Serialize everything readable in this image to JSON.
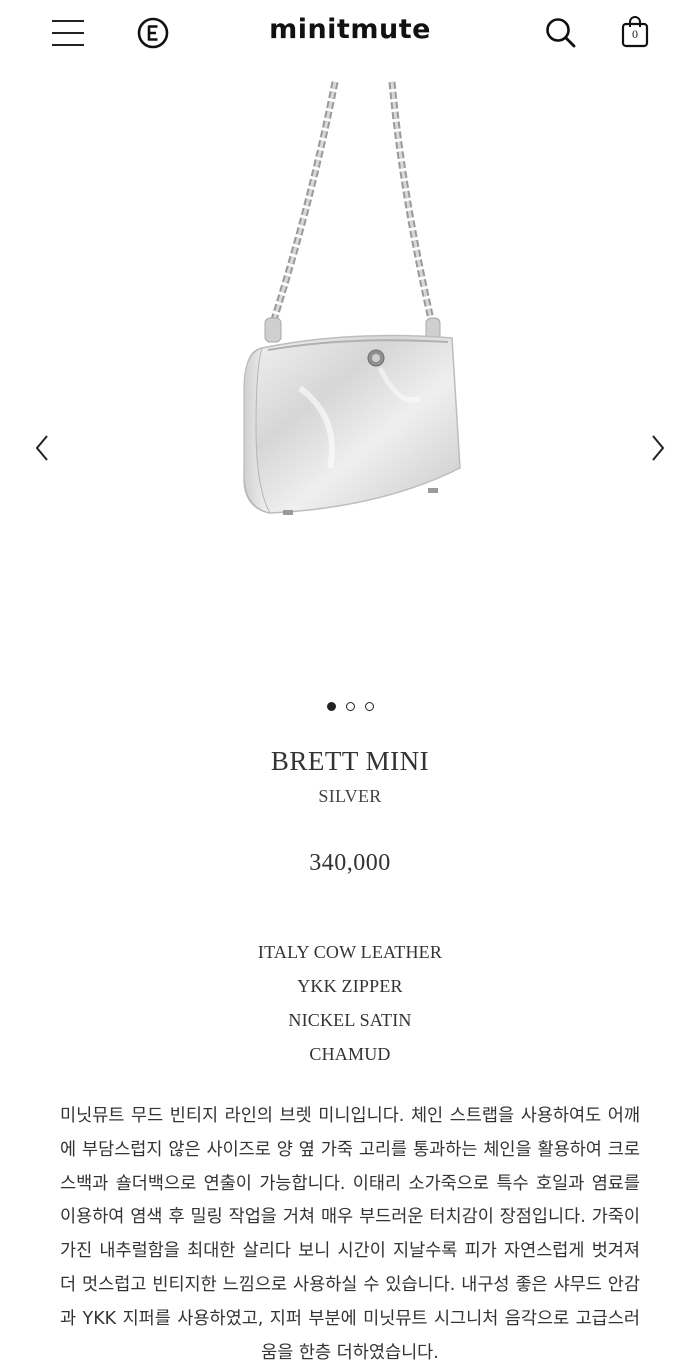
{
  "header": {
    "brand": "minitmute",
    "cart_count": "0"
  },
  "gallery": {
    "slide_count": 3,
    "active_index": 0
  },
  "product": {
    "name": "BRETT MINI",
    "color": "SILVER",
    "price": "340,000",
    "specs": [
      "ITALY COW LEATHER",
      "YKK ZIPPER",
      "NICKEL SATIN",
      "CHAMUD"
    ],
    "description": "미닛뮤트 무드 빈티지 라인의 브렛 미니입니다. 체인 스트랩을 사용하여도 어깨에 부담스럽지 않은 사이즈로 양 옆 가죽 고리를 통과하는 체인을 활용하여 크로스백과 숄더백으로 연출이 가능합니다. 이태리 소가죽으로 특수 호일과 염료를 이용하여 염색 후 밀링 작업을 거쳐 매우 부드러운 터치감이 장점입니다. 가죽이 가진 내추럴함을 최대한 살리다 보니 시간이 지날수록 피가 자연스럽게 벗겨져 더 멋스럽고 빈티지한 느낌으로 사용하실 수 있습니다. 내구성 좋은 샤무드 안감과 YKK 지퍼를 사용하였고, 지퍼 부분에 미닛뮤트 시그니처 음각으로 고급스러움을 한층 더하였습니다."
  },
  "icons": {
    "menu": "hamburger-icon",
    "logo": "brand-e-logo-icon",
    "search": "search-icon",
    "cart": "shopping-bag-icon",
    "prev": "chevron-left-icon",
    "next": "chevron-right-icon"
  },
  "colors": {
    "text": "#2a2a2a",
    "bag_silver": "#e4e4e4"
  }
}
